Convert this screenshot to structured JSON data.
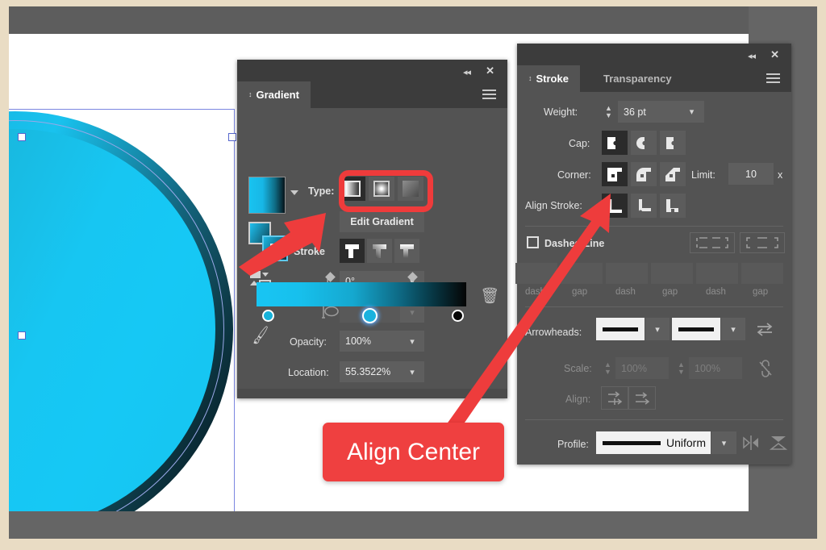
{
  "document": {
    "artwork": {
      "name": "circle-with-gradient-stroke",
      "fill_gradient_from": "#17c6f2",
      "fill_gradient_to": "#1ca5c0",
      "stroke_gradient": [
        "#19c2ee",
        "#13627a",
        "#04141a"
      ],
      "selection_color": "#7b86e0"
    }
  },
  "gradient_panel": {
    "tab_label": "Gradient",
    "collapse_icon": "◂◂",
    "close_icon": "✕",
    "menu_icon": "hamburger",
    "type_label": "Type:",
    "type_options": [
      "linear",
      "radial",
      "freeform"
    ],
    "type_selected": "linear",
    "edit_gradient_label": "Edit Gradient",
    "stroke_label": "Stroke",
    "stroke_options": [
      "within-stroke",
      "along-stroke",
      "across-stroke"
    ],
    "stroke_selected": "within-stroke",
    "angle_label": "⊥",
    "angle_value": "0°",
    "aspect_label": "aspect-ratio",
    "aspect_value": "",
    "opacity_label": "Opacity:",
    "opacity_value": "100%",
    "location_label": "Location:",
    "location_value": "55.3522%",
    "delete_stop_icon": "trash-icon",
    "eyedropper_icon": "eyedropper-icon",
    "stops": [
      {
        "position": 0,
        "color": "#18b9e4"
      },
      {
        "position": 50,
        "color": "#1bb4e0"
      },
      {
        "position": 100,
        "color": "#0a0a0a"
      }
    ],
    "midpoints": [
      28,
      66
    ]
  },
  "stroke_panel": {
    "tabs": [
      {
        "label": "Stroke",
        "active": true
      },
      {
        "label": "Transparency",
        "active": false
      }
    ],
    "collapse_icon": "◂◂",
    "close_icon": "✕",
    "menu_icon": "hamburger",
    "weight_label": "Weight:",
    "weight_value": "36 pt",
    "cap_label": "Cap:",
    "cap_options": [
      "butt-cap",
      "round-cap",
      "projecting-cap"
    ],
    "cap_selected": "butt-cap",
    "corner_label": "Corner:",
    "corner_options": [
      "miter-join",
      "round-join",
      "bevel-join"
    ],
    "corner_selected": "miter-join",
    "limit_label": "Limit:",
    "limit_value": "10",
    "limit_unit": "x",
    "align_stroke_label": "Align Stroke:",
    "align_options": [
      "align-center",
      "align-inside",
      "align-outside"
    ],
    "align_selected": "align-center",
    "dashed_line_label": "Dashed Line",
    "dashed_line_checked": false,
    "dash_preserve_options": [
      "preserve-exact-dash",
      "align-dashes-to-corners"
    ],
    "dash_fields": [
      "",
      "",
      "",
      "",
      "",
      ""
    ],
    "dash_field_labels": [
      "dash",
      "gap",
      "dash",
      "gap",
      "dash",
      "gap"
    ],
    "arrowheads_label": "Arrowheads:",
    "arrowhead_start": "None",
    "arrowhead_end": "None",
    "swap_arrowheads_icon": "swap-icon",
    "scale_label": "Scale:",
    "scale_start_value": "100%",
    "scale_end_value": "100%",
    "link_scale_icon": "broken-link-icon",
    "align_label": "Align:",
    "align_dash_options": [
      "extend-arrow-tip",
      "place-arrow-tip-at-end"
    ],
    "profile_label": "Profile:",
    "profile_value": "Uniform",
    "flip_across_icon": "flip-across-icon",
    "flip_along_icon": "flip-along-icon"
  },
  "annotations": {
    "callout_text": "Align Center",
    "accent_color": "#ef4040",
    "highlight_target": "gradient-stroke-options",
    "arrow_targets": [
      "gradient-stroke-options",
      "align-stroke-center-button"
    ]
  }
}
